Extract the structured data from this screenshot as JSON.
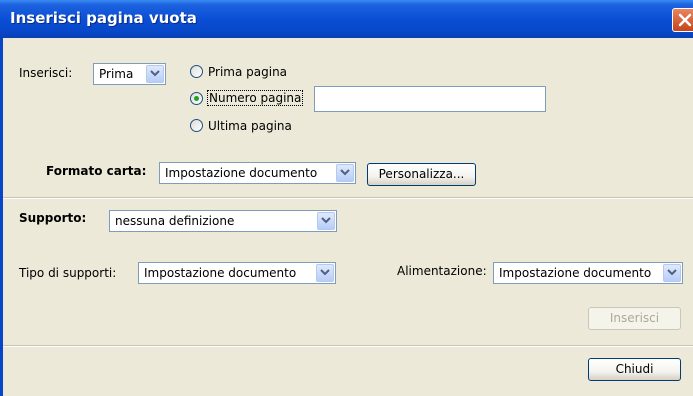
{
  "window": {
    "title": "Inserisci pagina vuota"
  },
  "insert": {
    "label": "Inserisci:",
    "position_value": "Prima",
    "radio_options": [
      {
        "label": "Prima pagina",
        "selected": false
      },
      {
        "label": "Numero pagina",
        "selected": true
      },
      {
        "label": "Ultima pagina",
        "selected": false
      }
    ],
    "page_number_value": ""
  },
  "paper": {
    "label": "Formato carta:",
    "value": "Impostazione documento",
    "customize_button": "Personalizza..."
  },
  "media": {
    "label": "Supporto:",
    "value": "nessuna definizione",
    "type_label": "Tipo di supporti:",
    "type_value": "Impostazione documento",
    "feed_label": "Alimentazione:",
    "feed_value": "Impostazione documento",
    "insert_button": "Inserisci",
    "insert_button_enabled": false
  },
  "footer": {
    "close_button": "Chiudi"
  },
  "colors": {
    "titlebar": "#0a4fd6",
    "dialog_bg": "#ece9d8",
    "radio_dot": "#21a121",
    "close_red": "#c6431b"
  }
}
